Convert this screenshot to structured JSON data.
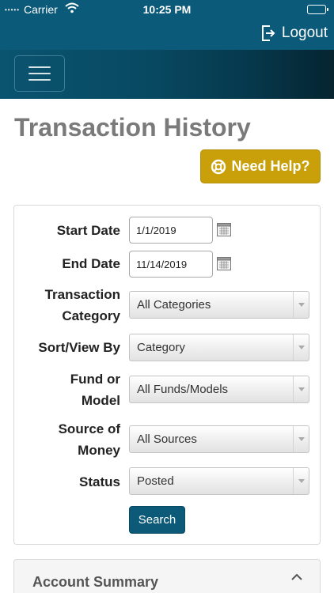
{
  "status_bar": {
    "signal": "•••••",
    "carrier": "Carrier",
    "time": "10:25 PM"
  },
  "header": {
    "logout_label": "Logout"
  },
  "page": {
    "title": "Transaction History",
    "help_label": "Need Help?"
  },
  "filters": {
    "start_date": {
      "label": "Start Date",
      "value": "1/1/2019"
    },
    "end_date": {
      "label": "End Date",
      "value": "11/14/2019"
    },
    "transaction_category": {
      "label_line1": "Transaction",
      "label_line2": "Category",
      "value": "All Categories"
    },
    "sort_view_by": {
      "label": "Sort/View By",
      "value": "Category"
    },
    "fund_or_model": {
      "label_line1": "Fund or",
      "label_line2": "Model",
      "value": "All Funds/Models"
    },
    "source_of_money": {
      "label_line1": "Source of",
      "label_line2": "Money",
      "value": "All Sources"
    },
    "status": {
      "label": "Status",
      "value": "Posted"
    },
    "search_label": "Search"
  },
  "summary": {
    "title": "Account Summary"
  },
  "colors": {
    "header_bg": "#0b5a7a",
    "help_button": "#c9a009",
    "search_button": "#0c5a78",
    "title_text": "#7a7a7a"
  },
  "icons": {
    "wifi": "wifi-icon",
    "battery": "battery-icon",
    "logout": "logout-icon",
    "menu": "hamburger-menu-icon",
    "help": "lifebuoy-icon",
    "calendar": "calendar-icon",
    "caret": "caret-down-icon",
    "chevron": "chevron-up-icon"
  }
}
